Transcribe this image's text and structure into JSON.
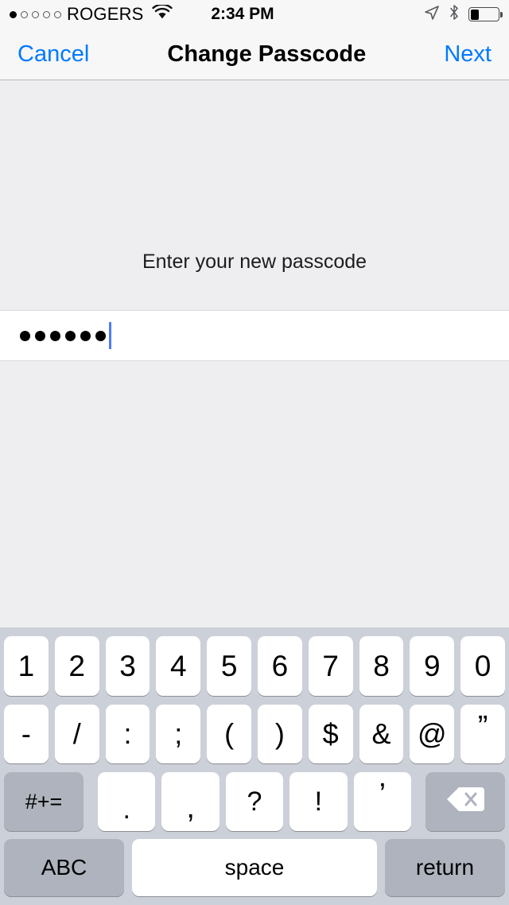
{
  "status_bar": {
    "signal_dots": {
      "total": 5,
      "filled": 1
    },
    "carrier": "ROGERS",
    "wifi_icon": "wifi-icon",
    "time": "2:34 PM",
    "location_icon": "location-arrow-icon",
    "bluetooth_icon": "bluetooth-icon",
    "battery": {
      "icon": "battery-icon",
      "level_percent": 30
    }
  },
  "nav_bar": {
    "cancel_label": "Cancel",
    "title": "Change Passcode",
    "next_label": "Next",
    "tint_color": "#007aff"
  },
  "content": {
    "prompt": "Enter your new passcode",
    "passcode_field": {
      "dot_count": 6,
      "caret_visible": true,
      "caret_color": "#4a7dfc"
    },
    "background_color": "#eeeef1"
  },
  "keyboard": {
    "background_color": "#ccd0d8",
    "row1": [
      "1",
      "2",
      "3",
      "4",
      "5",
      "6",
      "7",
      "8",
      "9",
      "0"
    ],
    "row2": [
      "-",
      "/",
      ":",
      ";",
      "(",
      ")",
      "$",
      "&",
      "@",
      "”"
    ],
    "row3": {
      "symbols_key": "#+=",
      "keys": [
        ".",
        ",",
        "?",
        "!",
        "’"
      ],
      "backspace_icon": "backspace-delete-icon"
    },
    "row4": {
      "abc_key": "ABC",
      "space_key": "space",
      "return_key": "return"
    }
  }
}
